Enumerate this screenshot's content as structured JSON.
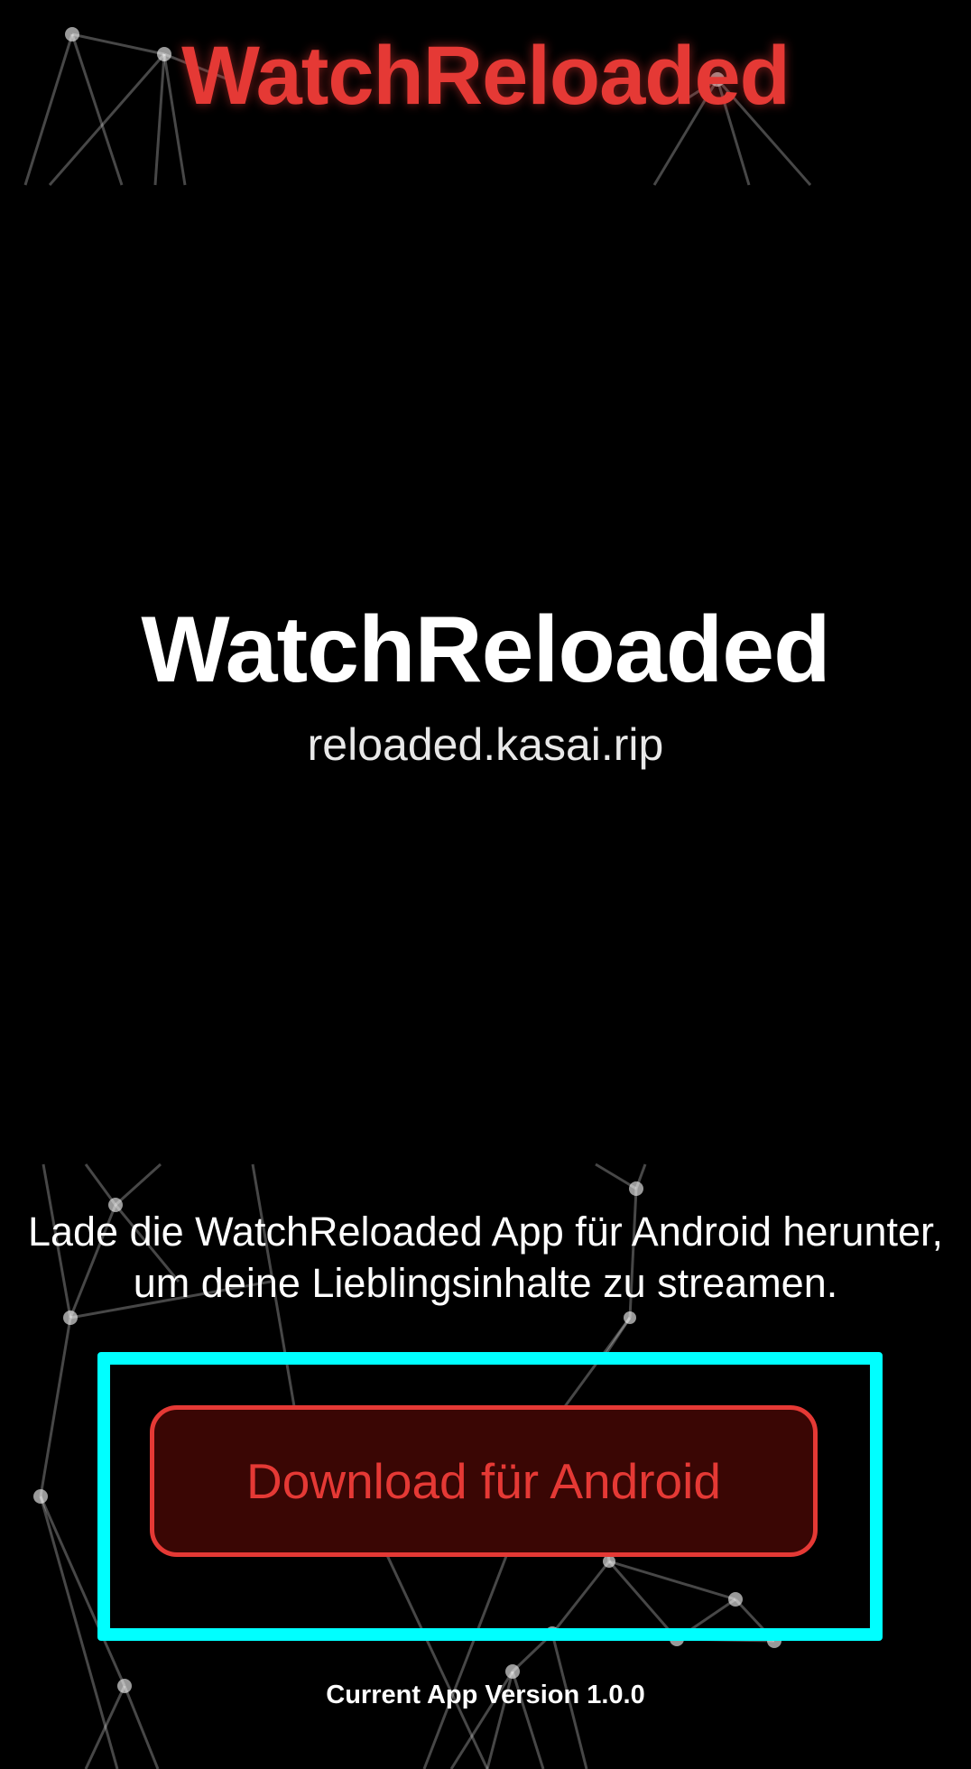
{
  "header": {
    "title": "WatchReloaded"
  },
  "hero": {
    "title": "WatchReloaded",
    "domain": "reloaded.kasai.rip"
  },
  "description": {
    "line1": "Lade die WatchReloaded App für Android herunter,",
    "line2": "um deine Lieblingsinhalte zu streamen."
  },
  "download_button": {
    "label": "Download für Android"
  },
  "footer": {
    "version": "Current App Version 1.0.0"
  },
  "colors": {
    "background": "#000000",
    "accent_red": "#e53935",
    "button_fill": "#3a0604",
    "focus_outline": "#00ffff"
  }
}
